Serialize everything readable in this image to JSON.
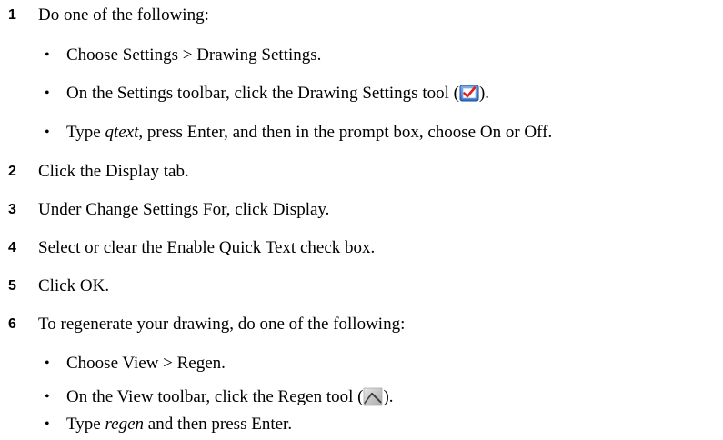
{
  "steps": [
    {
      "num": "1",
      "text": "Do one of the following:"
    },
    {
      "num": "2",
      "text": "Click the Display tab."
    },
    {
      "num": "3",
      "text": "Under Change Settings For, click Display."
    },
    {
      "num": "4",
      "text": "Select or clear the Enable Quick Text check box."
    },
    {
      "num": "5",
      "text": "Click OK."
    },
    {
      "num": "6",
      "text": "To regenerate your drawing, do one of the following:"
    }
  ],
  "step1_options": {
    "opt1": "Choose Settings > Drawing Settings.",
    "opt2_before": "On the Settings toolbar, click the Drawing Settings tool (",
    "opt2_after": ").",
    "opt3_type": "Type ",
    "opt3_cmd": "qtext",
    "opt3_rest": ", press Enter, and then in the prompt box, choose On or Off."
  },
  "step6_options": {
    "opt1": "Choose View > Regen.",
    "opt2_before": "On the View toolbar, click the Regen tool (",
    "opt2_after": ").",
    "opt3_type": "Type ",
    "opt3_cmd": "regen",
    "opt3_rest": " and then press Enter."
  },
  "bullet_char": "•",
  "icons": {
    "drawing_settings": "drawing-settings-icon",
    "regen": "regen-icon"
  }
}
